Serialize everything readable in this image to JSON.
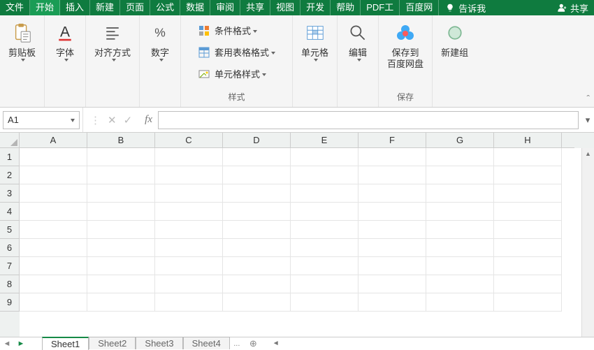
{
  "tabs": {
    "file": "文件",
    "home": "开始",
    "insert": "插入",
    "new": "新建",
    "page": "页面",
    "formula": "公式",
    "data": "数据",
    "review": "审阅",
    "share": "共享",
    "view": "视图",
    "dev": "开发",
    "help": "帮助",
    "pdf": "PDF工",
    "baidu": "百度网",
    "tell": "告诉我",
    "shareBtn": "共享"
  },
  "ribbon": {
    "clipboard": "剪贴板",
    "font": "字体",
    "align": "对齐方式",
    "number": "数字",
    "styles": {
      "group": "样式",
      "cond": "条件格式",
      "table": "套用表格格式",
      "cell": "单元格样式"
    },
    "cells": "单元格",
    "edit": "编辑",
    "baidu": {
      "btn": "保存到\n百度网盘",
      "group": "保存"
    },
    "newgroup": "新建组"
  },
  "fx": {
    "name": "A1",
    "fx": "fx"
  },
  "cols": [
    "A",
    "B",
    "C",
    "D",
    "E",
    "F",
    "G",
    "H"
  ],
  "rows": [
    "1",
    "2",
    "3",
    "4",
    "5",
    "6",
    "7",
    "8",
    "9"
  ],
  "sheets": {
    "s1": "Sheet1",
    "s2": "Sheet2",
    "s3": "Sheet3",
    "s4": "Sheet4",
    "more": "...",
    "add": "⊕"
  }
}
